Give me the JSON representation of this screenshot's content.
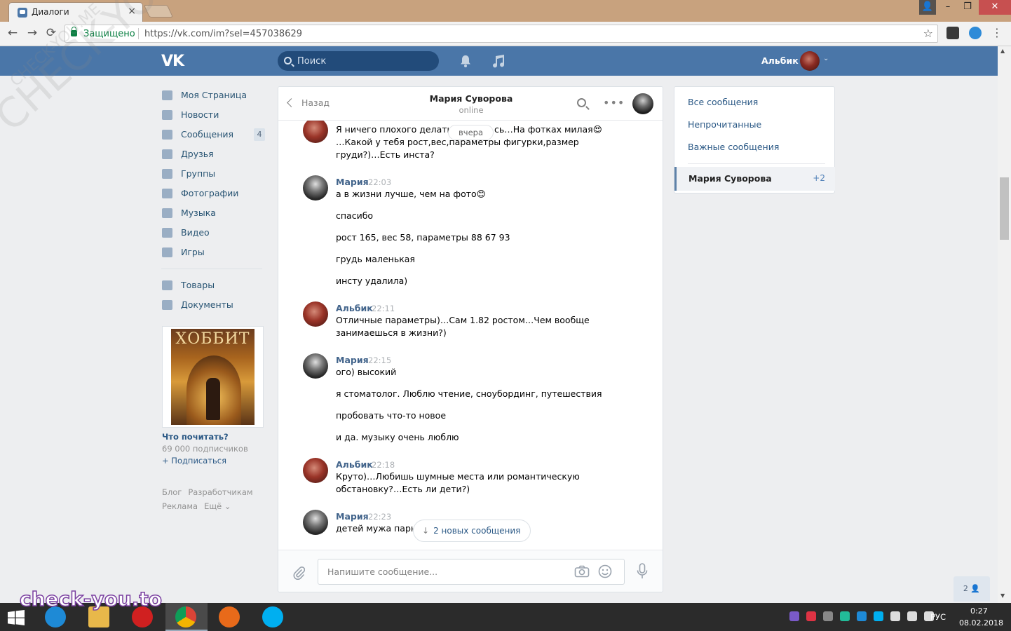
{
  "browser": {
    "tab_title": "Диалоги",
    "tab_close": "×",
    "window_user_glyph": "👤",
    "window_minimize": "–",
    "window_restore": "❐",
    "window_close": "✕",
    "secure_label": "Защищено",
    "url": "https://vk.com/im?sel=457038629",
    "back_glyph": "←",
    "forward_glyph": "→",
    "reload_glyph": "⟳",
    "star_glyph": "☆",
    "menu_glyph": "⋮"
  },
  "vk_header": {
    "logo": "VK",
    "search_placeholder": "Поиск",
    "user_name": "Альбик",
    "user_chevron": "⌄"
  },
  "left_nav": {
    "items": [
      {
        "label": "Моя Страница",
        "icon": "home-icon"
      },
      {
        "label": "Новости",
        "icon": "news-icon"
      },
      {
        "label": "Сообщения",
        "icon": "messages-icon",
        "badge": "4"
      },
      {
        "label": "Друзья",
        "icon": "friends-icon"
      },
      {
        "label": "Группы",
        "icon": "groups-icon"
      },
      {
        "label": "Фотографии",
        "icon": "photos-icon"
      },
      {
        "label": "Музыка",
        "icon": "music-icon"
      },
      {
        "label": "Видео",
        "icon": "video-icon"
      },
      {
        "label": "Игры",
        "icon": "games-icon"
      }
    ],
    "items2": [
      {
        "label": "Товары",
        "icon": "goods-icon"
      },
      {
        "label": "Документы",
        "icon": "documents-icon"
      }
    ],
    "ad": {
      "image_title": "ХОББИТ",
      "title": "Что почитать?",
      "subscribers": "69 000 подписчиков",
      "subscribe": "+ Подписаться"
    },
    "footer": [
      "Блог",
      "Разработчикам",
      "Реклама",
      "Ещё ⌄"
    ]
  },
  "chat": {
    "back_label": "Назад",
    "peer_name": "Мария Суворова",
    "peer_status": "online",
    "more_glyph": "•••",
    "date_divider": "вчера",
    "new_messages_arrow": "↓",
    "new_messages": "2 новых сообщения",
    "input_placeholder": "Напишите сообщение...",
    "messages": [
      {
        "author": "",
        "time": "",
        "lines": [
          "Я ничего плохого делать н",
          "…Какой у тебя рост,вес,параметры фигурки,размер",
          "груди?)…Есть инста?"
        ],
        "line_tail": "сь…На фотках милая😍"
      },
      {
        "author": "Мария",
        "time": "22:03",
        "lines": [
          "а в жизни лучше, чем на фото😊",
          "спасибо",
          "рост 165, вес 58, параметры 88 67 93",
          "грудь маленькая",
          "инсту удалила)"
        ]
      },
      {
        "author": "Альбик",
        "time": "22:11",
        "lines": [
          "Отличные параметры)…Сам 1.82 ростом…Чем вообще",
          "занимаешься в жизни?)"
        ]
      },
      {
        "author": "Мария",
        "time": "22:15",
        "lines": [
          "ого) высокий",
          "я стоматолог. Люблю чтение, сноубординг, путешествия",
          "пробовать что-то новое",
          "и да. музыку очень люблю"
        ]
      },
      {
        "author": "Альбик",
        "time": "22:18",
        "lines": [
          "Круто)…Любишь шумные места или романтическую",
          "обстановку?…Есть ли дети?)"
        ]
      },
      {
        "author": "Мария",
        "time": "22:23",
        "lines": [
          "детей мужа парня"
        ]
      }
    ]
  },
  "right_panel": {
    "items": [
      "Все сообщения",
      "Непрочитанные",
      "Важные сообщения"
    ],
    "active_dialog": {
      "name": "Мария Суворова",
      "count": "+2"
    }
  },
  "online_friends": "2 👤",
  "watermarks": {
    "diagonal": "CHECK-YOU.ME",
    "diagonal_small": "CHECK-YOU.ME",
    "bottom": "check-you.to"
  },
  "taskbar": {
    "apps": [
      "internet-explorer-icon",
      "file-explorer-icon",
      "opera-icon",
      "chrome-icon",
      "firefox-icon",
      "skype-icon"
    ],
    "language": "РУС",
    "time": "0:27",
    "date": "08.02.2018"
  },
  "colors": {
    "vk_blue": "#4a76a8",
    "link_blue": "#2a5885",
    "author_blue": "#42648b",
    "background": "#edeef0"
  }
}
